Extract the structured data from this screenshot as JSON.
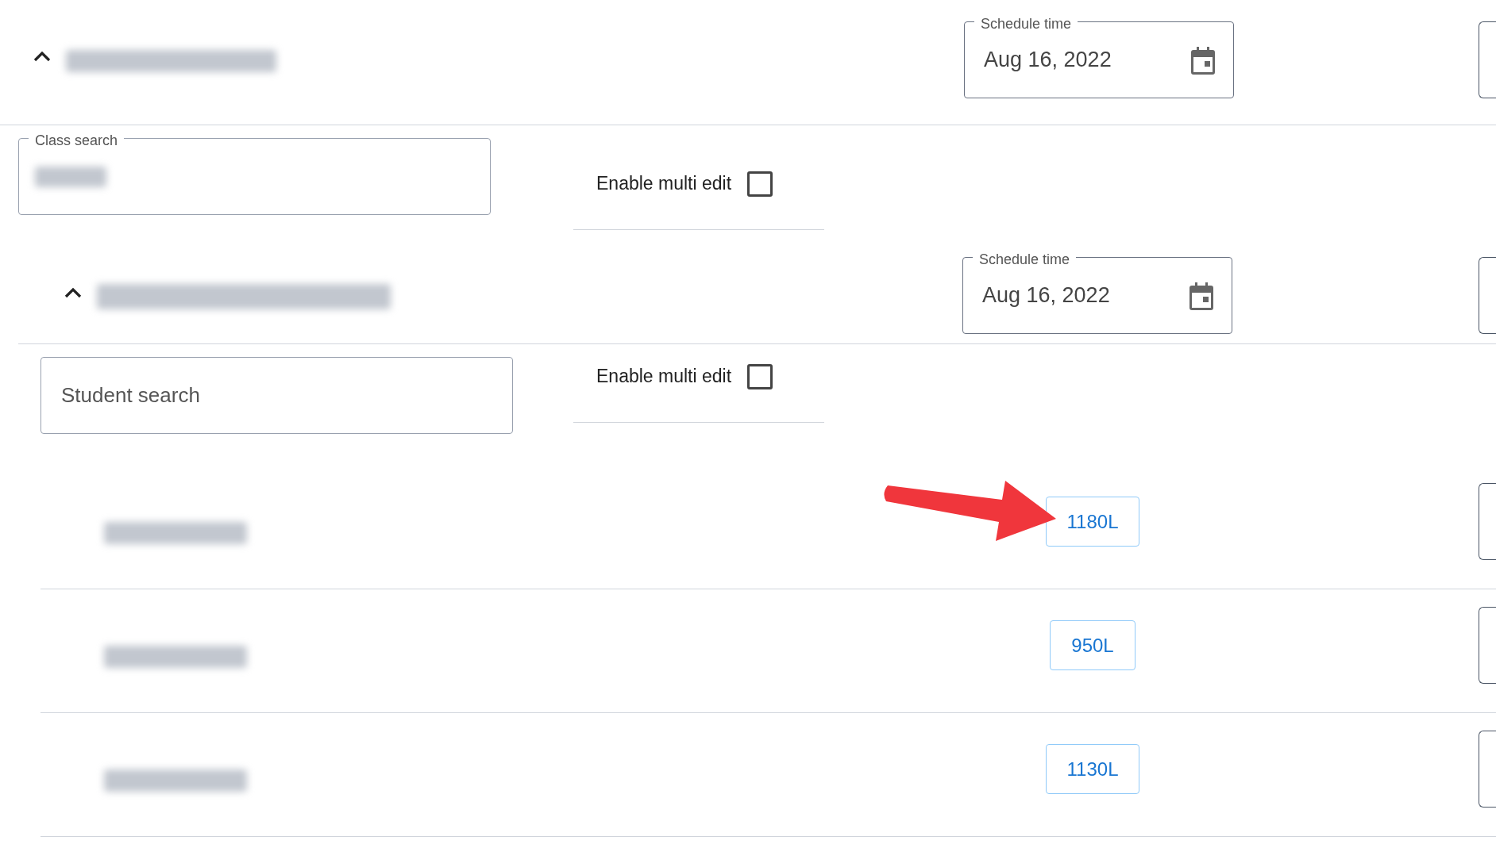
{
  "school_section": {
    "expanded": true,
    "schedule": {
      "label": "Schedule time",
      "value": "Aug 16, 2022"
    }
  },
  "class_search": {
    "label": "Class search"
  },
  "class_multi_edit": {
    "label": "Enable multi edit",
    "checked": false
  },
  "class_section": {
    "expanded": true,
    "schedule": {
      "label": "Schedule time",
      "value": "Aug 16, 2022"
    }
  },
  "student_search": {
    "placeholder": "Student search"
  },
  "student_multi_edit": {
    "label": "Enable multi edit",
    "checked": false
  },
  "students": [
    {
      "score": "1180L"
    },
    {
      "score": "950L"
    },
    {
      "score": "1130L"
    }
  ]
}
